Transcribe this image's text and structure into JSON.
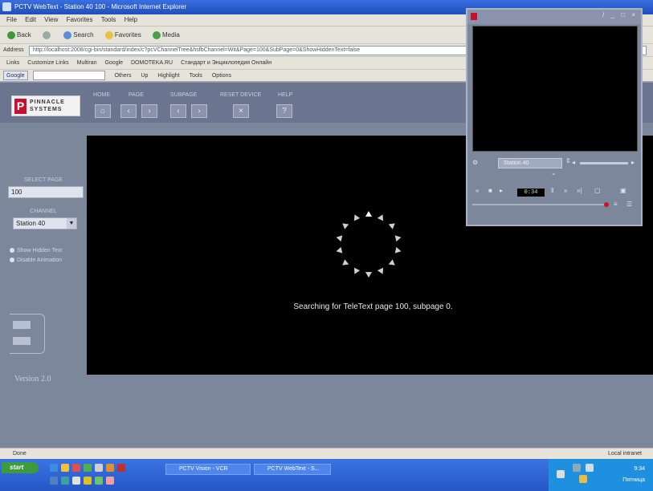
{
  "browser": {
    "title": "PCTV WebText - Station 40 100 - Microsoft Internet Explorer",
    "menu": [
      "File",
      "Edit",
      "View",
      "Favorites",
      "Tools",
      "Help"
    ],
    "toolbar": [
      "Back",
      "Search",
      "Favorites",
      "Media"
    ],
    "address_label": "Address",
    "address": "http://localhost:2008/cgi-bin/standard/index/c?pcVChannelTree&hsfbChannel=Wit&Page=100&SubPage=0&ShowHiddenText=false",
    "links": [
      "Links",
      "Customize Links",
      "Multiran",
      "Google",
      "DOMOTEKA.RU",
      "Стандарт и Энциклопедия Онлайн"
    ],
    "google_label": "Google",
    "google_items": [
      "Others",
      "Up",
      "Highlight",
      "Tools",
      "Options"
    ]
  },
  "page": {
    "nav_labels": [
      "HOME",
      "PAGE",
      "SUBPAGE",
      "RESET DEVICE",
      "HELP"
    ],
    "logo_letter": "P",
    "logo_text": [
      "PINNACLE",
      "SYSTEMS"
    ],
    "select_page_label": "SELECT PAGE",
    "page_value": "100",
    "channel_label": "CHANNEL",
    "channel_value": "Station 40",
    "checkboxes": [
      "Show Hidden Text",
      "Disable Animation"
    ],
    "version": "Version 2.0",
    "status_text": "Searching for TeleText page 100, subpage 0."
  },
  "player": {
    "channel": "Station 40",
    "display": "0:34",
    "window_controls": "/ _ □ ×"
  },
  "statusbar": {
    "left": "Done",
    "right": "Local intranet"
  },
  "taskbar": {
    "start": "start",
    "tasks": [
      "PCTV Vision - VCR",
      "PCTV WebText - S..."
    ],
    "clock": "9:34",
    "day": "Пятница"
  }
}
